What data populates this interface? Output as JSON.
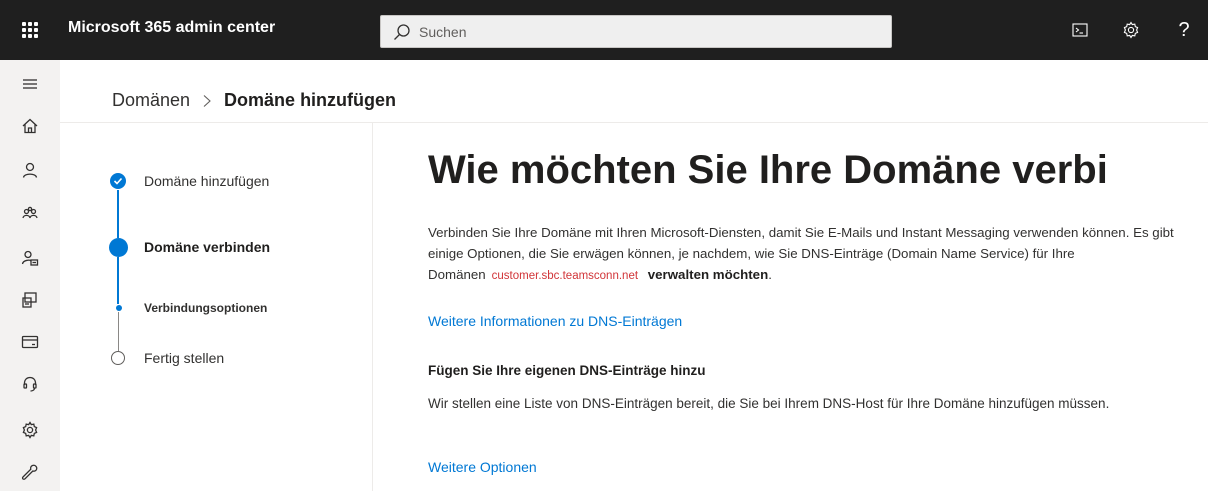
{
  "header": {
    "app_title": "Microsoft 365 admin center",
    "search_placeholder": "Suchen",
    "help_label": "?"
  },
  "nav_rail": {
    "icons": [
      "menu-icon",
      "home-icon",
      "user-icon",
      "group-icon",
      "user-badge-icon",
      "devices-icon",
      "billing-icon",
      "support-icon",
      "settings-icon",
      "setup-icon"
    ]
  },
  "breadcrumb": {
    "parent": "Domänen",
    "current": "Domäne hinzufügen"
  },
  "stepper": {
    "steps": [
      {
        "label": "Domäne hinzufügen",
        "state": "done"
      },
      {
        "label": "Domäne verbinden",
        "state": "current"
      },
      {
        "label": "Verbindungsoptionen",
        "state": "current-sub"
      },
      {
        "label": "Fertig stellen",
        "state": "todo"
      }
    ]
  },
  "main": {
    "title": "Wie möchten Sie Ihre Domäne verbi",
    "intro_part1": "Verbinden Sie Ihre Domäne mit Ihren Microsoft-Diensten, damit Sie E-Mails und Instant Messaging verwenden können. Es gibt einige Optionen, die Sie erwägen können, je nachdem, wie Sie DNS-Einträge (Domain Name Service) für Ihre Domänen",
    "domain": "customer.sbc.teamsconn.net",
    "intro_bold": "verwalten möchten",
    "intro_end": ".",
    "dns_link": "Weitere Informationen zu DNS-Einträgen",
    "option_heading": "Fügen Sie Ihre eigenen DNS-Einträge hinzu",
    "option_text": "Wir stellen eine Liste von DNS-Einträgen bereit, die Sie bei Ihrem DNS-Host für Ihre Domäne hinzufügen müssen.",
    "more_options_link": "Weitere Optionen"
  },
  "colors": {
    "topbar": "#1f1f1f",
    "accent": "#0078d4",
    "domain_text": "#d13438",
    "rail": "#f3f2f1"
  }
}
